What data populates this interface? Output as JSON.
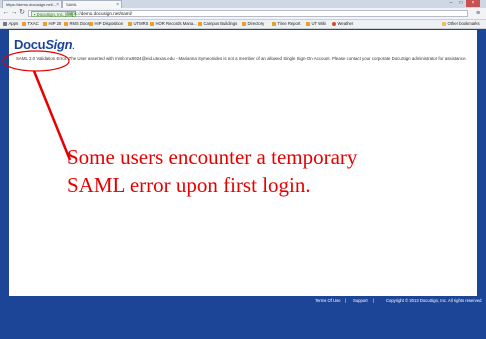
{
  "browser": {
    "tabs": [
      {
        "label": "https://demo.docusign.net/..."
      },
      {
        "label": "SAML"
      }
    ],
    "address_bar": {
      "secure_label": "DocuSign, Inc. [US]",
      "url_scheme": "https://",
      "url_rest": "demo.docusign.net/saml/"
    },
    "bookmarks": [
      {
        "label": "Apps",
        "icon": "apps-grid-icon"
      },
      {
        "label": "TXAC",
        "icon": "bookmark-icon"
      },
      {
        "label": "HIP 20",
        "icon": "bookmark-icon"
      },
      {
        "label": "RMS Docs",
        "icon": "bookmark-icon"
      },
      {
        "label": "HIP Disposition",
        "icon": "bookmark-icon"
      },
      {
        "label": "UTMRS",
        "icon": "bookmark-icon"
      },
      {
        "label": "HOR Records Mana...",
        "icon": "bookmark-icon"
      },
      {
        "label": "Campus Buildings",
        "icon": "bookmark-icon"
      },
      {
        "label": "Directory",
        "icon": "bookmark-icon"
      },
      {
        "label": "Time Report",
        "icon": "bookmark-icon"
      },
      {
        "label": "UT Wiki",
        "icon": "bookmark-icon"
      },
      {
        "label": "Weather",
        "icon": "weather-icon"
      },
      {
        "label": "Other bookmarks",
        "icon": "folder-icon"
      }
    ]
  },
  "page": {
    "logo": {
      "docu": "Docu",
      "sign": "Sign",
      "mark": "."
    },
    "error_message": "SAML 2.0 Validation Error: The User asserted with mmb:mx6924@eid.utexas.edu - Marianna Symeonides is not a member of an allowed Single Sign-On Account. Please contact your corporate DocuSign administrator for assistance.",
    "footer": {
      "terms": "Terms Of Use",
      "sep1": "|",
      "support": "Support",
      "sep2": "|",
      "copyright": "Copyright © 2013 DocuSign, Inc. All rights reserved"
    }
  },
  "annotation": {
    "line1": "Some users encounter a temporary",
    "line2": "SAML error upon first login.",
    "color": "#e60000"
  },
  "colors": {
    "brand_blue": "#1d4597",
    "annotation_red": "#e60000"
  }
}
